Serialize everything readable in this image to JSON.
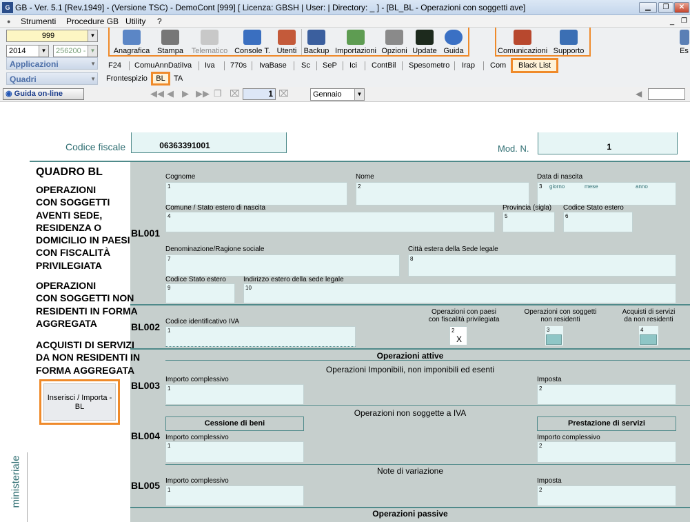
{
  "window": {
    "logo": "G",
    "title": "GB - Ver. 5.1 [Rev.1949] - (Versione TSC) - DemoCont [999]     [ Licenza: GBSH | User:                  | Directory:  _           ] - [BL_BL - Operazioni con soggetti ave]",
    "btn_minimize": "▁",
    "btn_restore": "❐",
    "btn_close": "✕"
  },
  "menu": {
    "strumenti": "Strumenti",
    "procedure": "Procedure GB",
    "utility": "Utility",
    "help": "?"
  },
  "mdi": {
    "minimize": "_",
    "restore": "❐"
  },
  "selectors": {
    "company": "999",
    "year": "2014",
    "code": "256200 -",
    "applicazioni": "Applicazioni",
    "quadri": "Quadri"
  },
  "toolbar": {
    "anagrafica": "Anagrafica",
    "stampa": "Stampa",
    "telematico": "Telematico",
    "console": "Console T.",
    "utenti": "Utenti",
    "backup": "Backup",
    "importazioni": "Importazioni",
    "opzioni": "Opzioni",
    "update": "Update",
    "guida": "Guida",
    "comunicazioni": "Comunicazioni",
    "supporto": "Supporto",
    "esci": "Es"
  },
  "app_tabs": [
    "F24",
    "ComuAnnDatiIva",
    "Iva",
    "770s",
    "IvaBase",
    "Sc",
    "SeP",
    "Ici",
    "ContBil",
    "Spesometro",
    "Irap",
    "Com",
    "Black List"
  ],
  "quadri_tabs": {
    "frontespizio": "Frontespizio",
    "bl": "BL",
    "ta": "TA"
  },
  "navbar": {
    "guida_online": "Guida on-line",
    "page": "1",
    "month": "Gennaio",
    "right_field": ""
  },
  "form": {
    "codice_fiscale_label": "Codice fiscale",
    "codice_fiscale": "06363391001",
    "mod_n_label": "Mod. N.",
    "mod_n": "1",
    "quadro_title": "QUADRO BL",
    "side_text_1": [
      "OPERAZIONI",
      "CON SOGGETTI",
      "AVENTI SEDE,",
      "RESIDENZA O",
      "DOMICILIO IN PAESI",
      "CON FISCALITÀ",
      "PRIVILEGIATA"
    ],
    "side_text_2": [
      "OPERAZIONI",
      "CON SOGGETTI NON",
      "RESIDENTI IN FORMA",
      "AGGREGATA"
    ],
    "side_text_3": [
      "ACQUISTI DI SERVIZI",
      "DA NON RESIDENTI IN",
      "FORMA AGGREGATA"
    ],
    "insert_button": "Inserisci / Importa - BL",
    "vertical_label": "ministeriale",
    "bl001": {
      "code": "BL001",
      "cognome": "Cognome",
      "cognome_n": "1",
      "nome": "Nome",
      "nome_n": "2",
      "data_nascita": "Data di nascita",
      "data_n": "3",
      "giorno": "giorno",
      "mese": "mese",
      "anno": "anno",
      "comune": "Comune / Stato estero di nascita",
      "comune_n": "4",
      "provincia": "Provincia (sigla)",
      "provincia_n": "5",
      "codice_stato": "Codice Stato estero",
      "codice_stato_n": "6",
      "denominazione": "Denominazione/Ragione sociale",
      "denominazione_n": "7",
      "citta": "Città estera della Sede legale",
      "citta_n": "8",
      "codice_stato2": "Codice Stato estero",
      "codice_stato2_n": "9",
      "indirizzo": "Indirizzo estero della sede legale",
      "indirizzo_n": "10"
    },
    "bl002": {
      "code": "BL002",
      "codice_iva": "Codice identificativo IVA",
      "codice_iva_n": "1",
      "op_paesi": "Operazioni con paesi\ncon fiscalità privilegiata",
      "op_paesi_n": "2",
      "op_paesi_val": "X",
      "op_non_res": "Operazioni con soggetti\nnon residenti",
      "op_non_res_n": "3",
      "acquisti": "Acquisti di servizi\nda non residenti",
      "acquisti_n": "4"
    },
    "operazioni_attive": "Operazioni attive",
    "imponibili_header": "Operazioni Imponibili, non imponibili ed esenti",
    "bl003": {
      "code": "BL003",
      "importo": "Importo complessivo",
      "importo_n": "1",
      "imposta": "Imposta",
      "imposta_n": "2"
    },
    "non_soggette_header": "Operazioni non soggette a IVA",
    "bl004": {
      "code": "BL004",
      "cessione": "Cessione di beni",
      "prestazione": "Prestazione di servizi",
      "importo": "Importo complessivo",
      "importo_n": "1",
      "importo2": "Importo complessivo",
      "importo2_n": "2"
    },
    "note_header": "Note di variazione",
    "bl005": {
      "code": "BL005",
      "importo": "Importo complessivo",
      "importo_n": "1",
      "imposta": "Imposta",
      "imposta_n": "2"
    },
    "operazioni_passive": "Operazioni passive"
  }
}
